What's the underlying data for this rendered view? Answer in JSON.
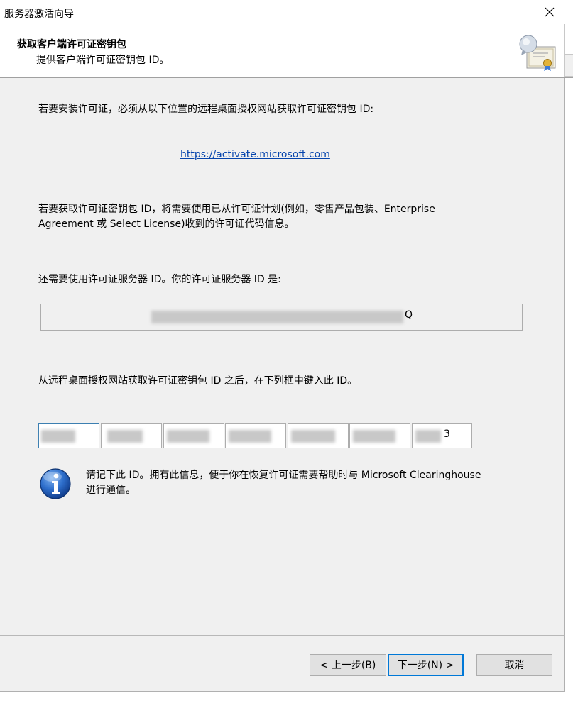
{
  "window": {
    "title": "服务器激活向导"
  },
  "header": {
    "title": "获取客户端许可证密钥包",
    "subtitle": "提供客户端许可证密钥包 ID。"
  },
  "icons": {
    "close": "close-icon",
    "header": "certificate-icon",
    "info": "info-icon"
  },
  "content": {
    "intro": "若要安装许可证，必须从以下位置的远程桌面授权网站获取许可证密钥包 ID:",
    "link": "https://activate.microsoft.com",
    "program_line1": "若要获取许可证密钥包 ID，将需要使用已从许可证计划(例如，零售产品包装、Enterprise",
    "program_line2": "Agreement 或 Select License)收到的许可证代码信息。",
    "server_id_label": "还需要使用许可证服务器 ID。你的许可证服务器 ID 是:",
    "server_id_visible_tail": "Q",
    "enter_id_label": "从远程桌面授权网站获取许可证密钥包 ID 之后，在下列框中键入此 ID。",
    "key_fields": [
      "",
      "",
      "",
      "",
      "",
      "",
      "3"
    ],
    "info_line1": "请记下此 ID。拥有此信息，便于你在恢复许可证需要帮助时与 Microsoft Clearinghouse",
    "info_line2": "进行通信。"
  },
  "footer": {
    "back_label": "< 上一步(B)",
    "next_label": "下一步(N) >",
    "cancel_label": "取消"
  },
  "colors": {
    "accent": "#0078d7",
    "link": "#0645ad",
    "panel": "#f0f0f0"
  }
}
